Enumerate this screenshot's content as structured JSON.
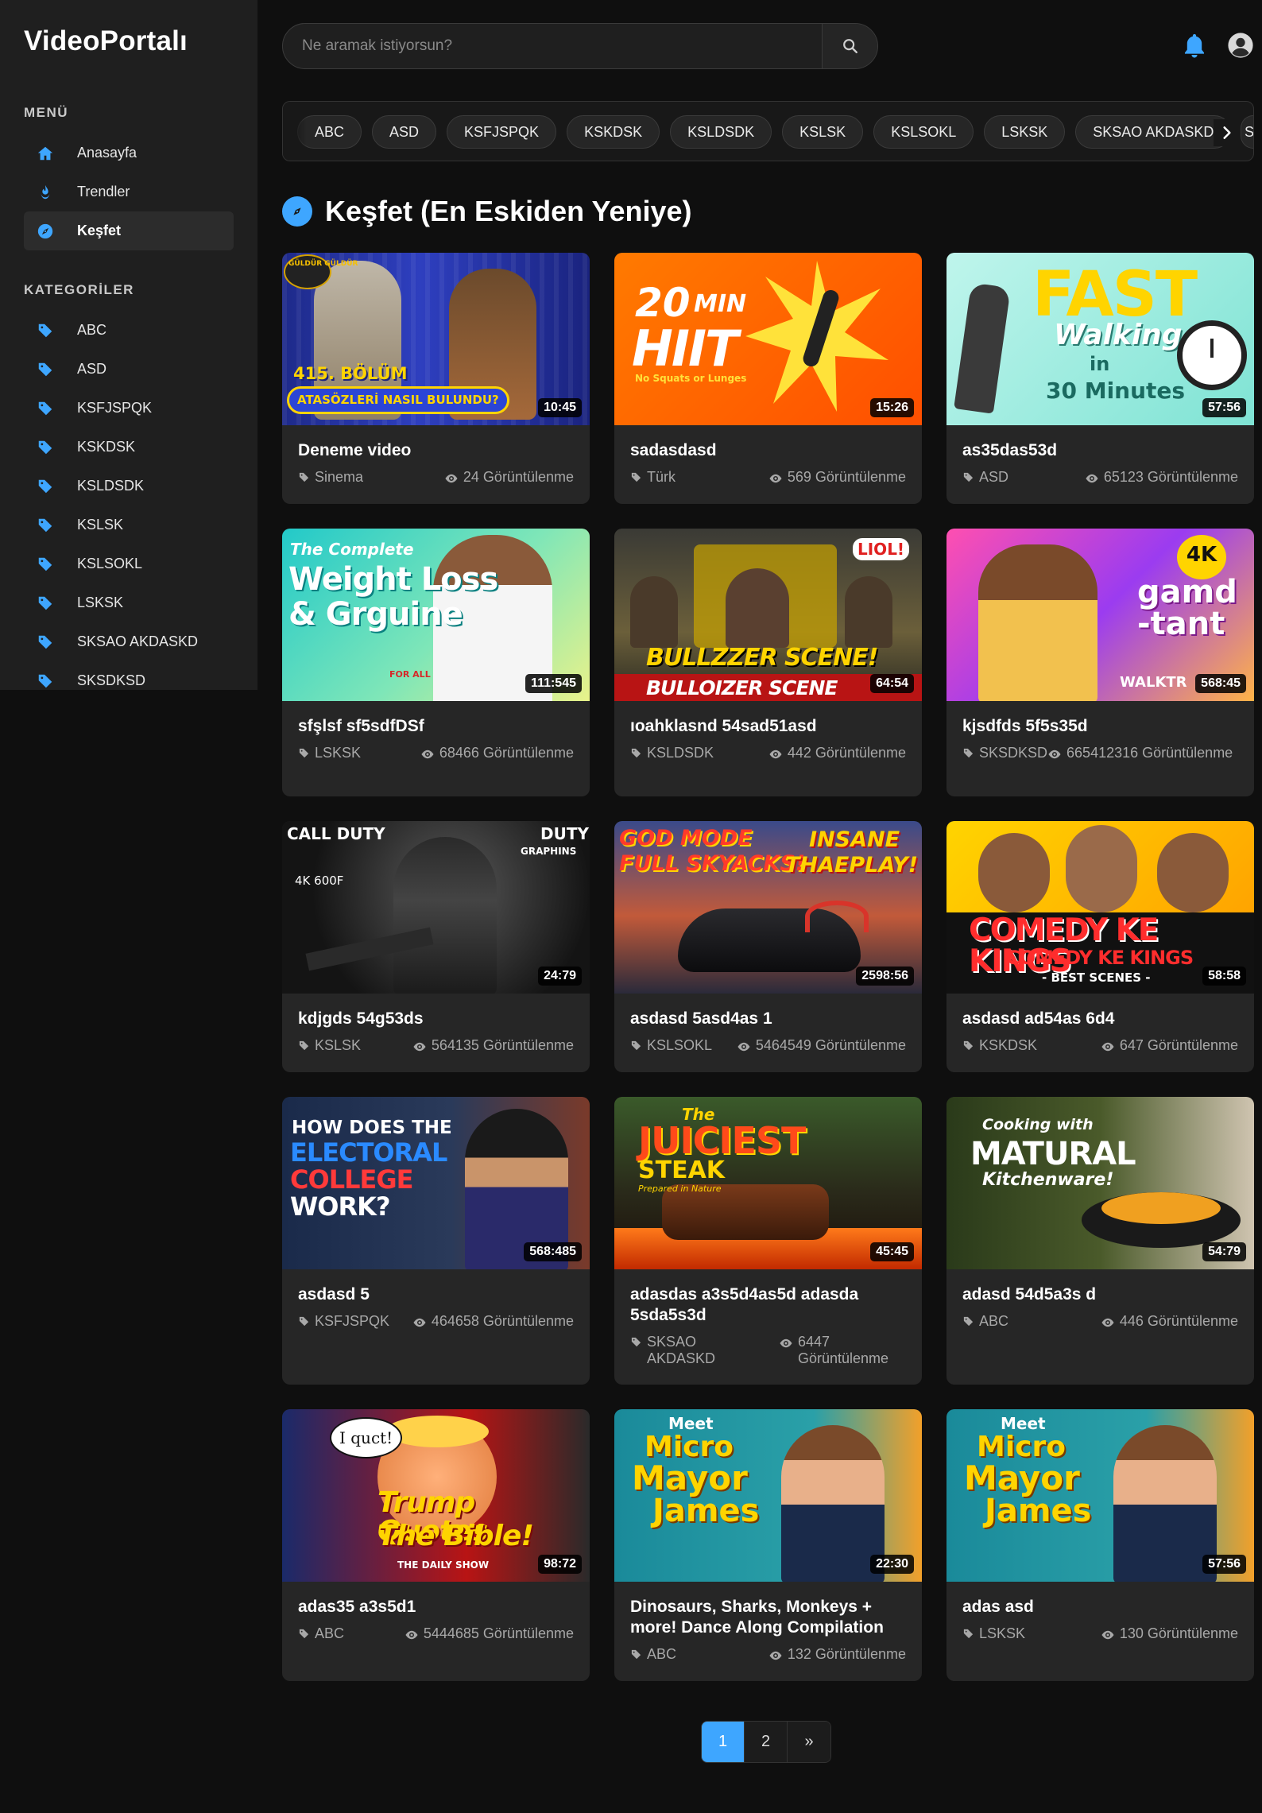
{
  "app": {
    "logo": "VideoPortalı"
  },
  "sidebar": {
    "menu_heading": "MENÜ",
    "menu": [
      {
        "label": "Anasayfa",
        "icon": "home-icon"
      },
      {
        "label": "Trendler",
        "icon": "fire-icon"
      },
      {
        "label": "Keşfet",
        "icon": "compass-icon",
        "active": true
      }
    ],
    "categories_heading": "KATEGORİLER",
    "categories": [
      "ABC",
      "ASD",
      "KSFJSPQK",
      "KSKDSK",
      "KSLDSDK",
      "KSLSK",
      "KSLSOKL",
      "LSKSK",
      "SKSAO AKDASKD",
      "SKSDKSD"
    ]
  },
  "search": {
    "placeholder": "Ne aramak istiyorsun?",
    "value": ""
  },
  "tagbar": {
    "tags": [
      "ABC",
      "ASD",
      "KSFJSPQK",
      "KSKDSK",
      "KSLDSDK",
      "KSLSK",
      "KSLSOKL",
      "LSKSK",
      "SKSAO AKDASKD"
    ],
    "tail": "SK"
  },
  "section": {
    "title": "Keşfet (En Eskiden Yeniye)"
  },
  "videos": [
    {
      "title": "Deneme video",
      "category": "Sinema",
      "views": "24 Görüntülenme",
      "duration": "10:45",
      "thumb_text": [
        "415. BÖLÜM",
        "ATASÖZLERİ NASIL BULUNDU?",
        "GÜLDÜR GÜLDÜR"
      ]
    },
    {
      "title": "sadasdasd",
      "category": "Türk",
      "views": "569 Görüntülenme",
      "duration": "15:26",
      "thumb_text": [
        "20",
        "MIN",
        "HIIT",
        "No Squats or Lunges"
      ]
    },
    {
      "title": "as35das53d",
      "category": "ASD",
      "views": "65123 Görüntülenme",
      "duration": "57:56",
      "thumb_text": [
        "FAST",
        "Walking",
        "in",
        "30 Minutes"
      ]
    },
    {
      "title": "sfşlsf sf5sdfDSf",
      "category": "LSKSK",
      "views": "68466 Görüntülenme",
      "duration": "111:545",
      "thumb_text": [
        "The Complete",
        "Weight Loss",
        "& Grguine",
        "FOR ALL"
      ]
    },
    {
      "title": "ıoahklasnd 54sad51asd",
      "category": "KSLDSDK",
      "views": "442 Görüntülenme",
      "duration": "64:54",
      "thumb_text": [
        "BULLZZER SCENE!",
        "BULLOIZER SCENE",
        "LIOL!"
      ]
    },
    {
      "title": "kjsdfds 5f5s35d",
      "category": "SKSDKSD",
      "views": "665412316 Görüntülenme",
      "duration": "568:45",
      "thumb_text": [
        "4K",
        "gamd",
        "-tant",
        "WALKTR"
      ]
    },
    {
      "title": "kdjgds 54g53ds",
      "category": "KSLSK",
      "views": "564135 Görüntülenme",
      "duration": "24:79",
      "thumb_text": [
        "CALL DUTY",
        "DUTY",
        "GRAPHINS",
        "4K 600F"
      ]
    },
    {
      "title": "asdasd 5asd4as 1",
      "category": "KSLSOKL",
      "views": "5464549 Görüntülenme",
      "duration": "2598:56",
      "thumb_text": [
        "GOD MODE",
        "FULL SKYACKS!",
        "INSANE",
        "THAEPLAY!"
      ]
    },
    {
      "title": "asdasd ad54as 6d4",
      "category": "KSKDSK",
      "views": "647 Görüntülenme",
      "duration": "58:58",
      "thumb_text": [
        "COMEDY KE KINGS",
        "COMEDY KE KINGS",
        "- BEST SCENES -"
      ]
    },
    {
      "title": "asdasd 5",
      "category": "KSFJSPQK",
      "views": "464658 Görüntülenme",
      "duration": "568:485",
      "thumb_text": [
        "HOW DOES THE",
        "ELECTORAL",
        "COLLEGE",
        "WORK?"
      ]
    },
    {
      "title": "adasdas a3s5d4as5d adasda 5sda5s3d",
      "category": "SKSAO AKDASKD",
      "views": "6447 Görüntülenme",
      "duration": "45:45",
      "thumb_text": [
        "The",
        "JUICIEST",
        "STEAK",
        "Prepared in Nature"
      ]
    },
    {
      "title": "adasd 54d5a3s d",
      "category": "ABC",
      "views": "446 Görüntülenme",
      "duration": "54:79",
      "thumb_text": [
        "Cooking with",
        "MATURAL",
        "Kitchenware!"
      ]
    },
    {
      "title": "adas35 a3s5d1",
      "category": "ABC",
      "views": "5444685 Görüntülenme",
      "duration": "98:72",
      "thumb_text": [
        "I quct!",
        "Trump Quotes",
        "The Bible!",
        "THE DAILY SHOW"
      ]
    },
    {
      "title": "Dinosaurs, Sharks, Monkeys + more! Dance Along Compilation",
      "category": "ABC",
      "views": "132 Görüntülenme",
      "duration": "22:30",
      "thumb_text": [
        "Meet",
        "Micro",
        "Mayor",
        "James"
      ]
    },
    {
      "title": "adas asd",
      "category": "LSKSK",
      "views": "130 Görüntülenme",
      "duration": "57:56",
      "thumb_text": [
        "Meet",
        "Micro",
        "Mayor",
        "James"
      ]
    }
  ],
  "pagination": {
    "pages": [
      "1",
      "2"
    ],
    "next": "»",
    "current": "1"
  },
  "colors": {
    "accent": "#3ea6ff",
    "background": "#0f0f0f",
    "card": "#262626"
  }
}
